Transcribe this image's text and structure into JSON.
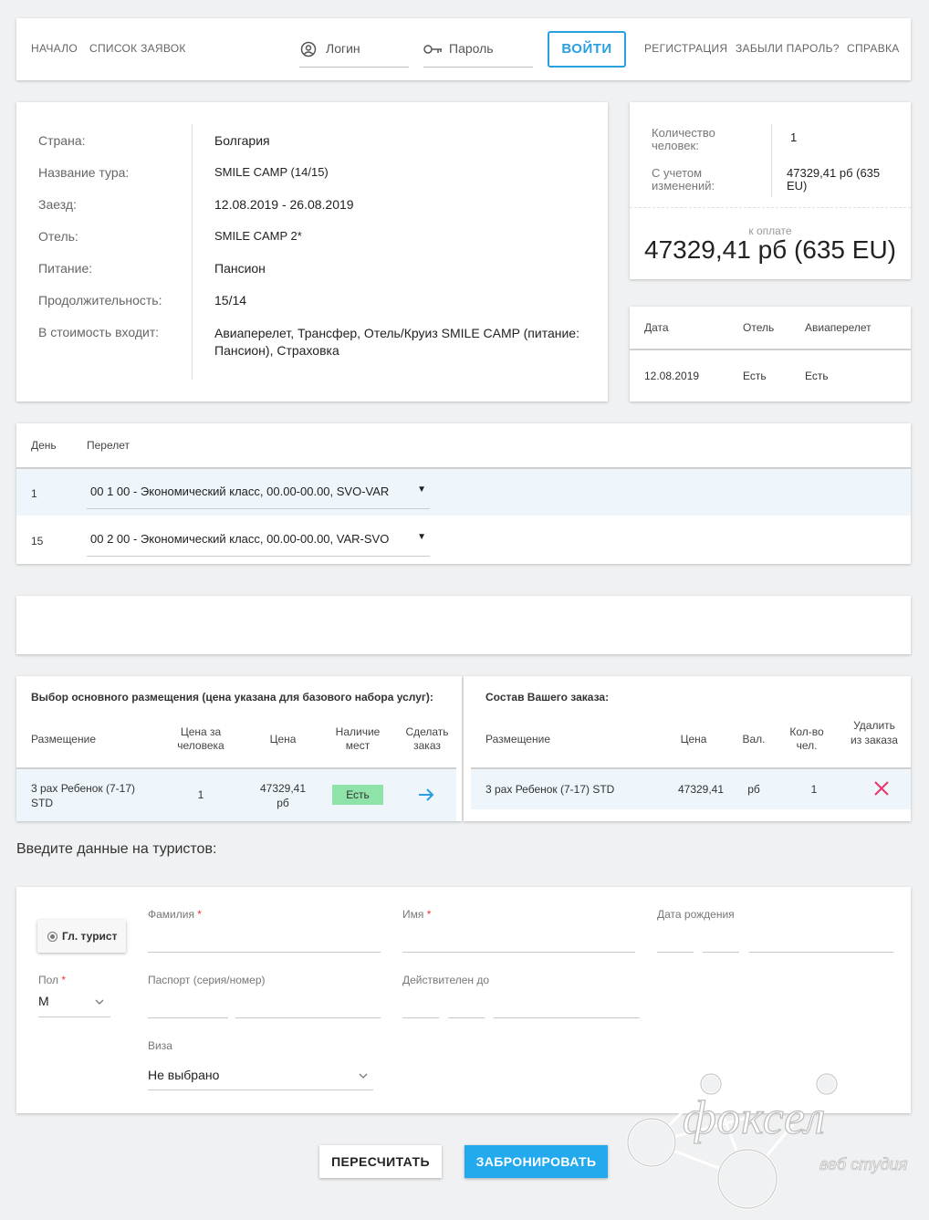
{
  "header": {
    "nav_left": [
      "НАЧАЛО",
      "СПИСОК ЗАЯВОК"
    ],
    "login_placeholder": "Логин",
    "password_placeholder": "Пароль",
    "login_button": "ВОЙТИ",
    "nav_right": [
      "РЕГИСТРАЦИЯ",
      "ЗАБЫЛИ ПАРОЛЬ?",
      "СПРАВКА"
    ]
  },
  "tour": {
    "rows": [
      {
        "label": "Страна:",
        "value": "Болгария",
        "link": false
      },
      {
        "label": "Название тура:",
        "value": "SMILE CAMP (14/15)",
        "link": true
      },
      {
        "label": "Заезд:",
        "value": "12.08.2019 - 26.08.2019",
        "link": false
      },
      {
        "label": "Отель:",
        "value": "SMILE CAMP 2*",
        "link": true
      },
      {
        "label": "Питание:",
        "value": "Пансион",
        "link": false
      },
      {
        "label": "Продолжительность:",
        "value": "15/14",
        "link": false
      },
      {
        "label": "В стоимость входит:",
        "value": "Авиаперелет, Трансфер, Отель/Круиз SMILE CAMP (питание: Пансион), Страховка",
        "link": false
      }
    ]
  },
  "summary": {
    "people_label": "Количество человек:",
    "people_value": "1",
    "changes_label": "С учетом изменений:",
    "changes_value": "47329,41 рб (635 EU)",
    "to_pay_label": "к оплате",
    "to_pay_value": "47329,41 рб (635 EU)"
  },
  "dates_table": {
    "headers": [
      "Дата",
      "Отель",
      "Авиаперелет"
    ],
    "row": [
      "12.08.2019",
      "Есть",
      "Есть"
    ]
  },
  "flights": {
    "headers": [
      "День",
      "Перелет"
    ],
    "rows": [
      {
        "day": "1",
        "flight": "00 1 00 - Экономический класс, 00.00-00.00, SVO-VAR"
      },
      {
        "day": "15",
        "flight": "00 2 00 - Экономический класс, 00.00-00.00, VAR-SVO"
      }
    ]
  },
  "accommodation": {
    "title": "Выбор основного размещения (цена указана для базового набора услуг):",
    "headers": [
      "Размещение",
      "Цена за человека",
      "Цена",
      "Наличие мест",
      "Сделать заказ"
    ],
    "row": {
      "placement": "3 pax Ребенок (7-17) STD",
      "per_person": "1",
      "price": "47329,41 рб",
      "availability": "Есть"
    }
  },
  "order": {
    "title": "Состав Вашего заказа:",
    "headers": [
      "Размещение",
      "Цена",
      "Вал.",
      "Кол-во чел.",
      "Удалить из заказа"
    ],
    "row": {
      "placement": "3 pax Ребенок (7-17) STD",
      "price": "47329,41",
      "currency": "рб",
      "count": "1"
    }
  },
  "tourists": {
    "heading": "Введите данные на туристов:",
    "main_tourist": "Гл. турист",
    "surname_label": "Фамилия",
    "name_label": "Имя",
    "birth_label": "Дата рождения",
    "sex_label": "Пол",
    "sex_value": "М",
    "passport_label": "Паспорт (серия/номер)",
    "valid_label": "Действителен до",
    "visa_label": "Виза",
    "visa_value": "Не выбрано",
    "required_mark": "*"
  },
  "actions": {
    "recalc": "ПЕРЕСЧИТАТЬ",
    "book": "ЗАБРОНИРОВАТЬ"
  },
  "watermark": {
    "brand": "фоксел",
    "sub": "веб студия"
  },
  "colors": {
    "accent": "#2a9fe0",
    "link": "#2a95d9",
    "primary_button": "#22a9ee",
    "available_badge": "#8fe3a8",
    "delete": "#e8356b",
    "row_highlight": "#eef6fb"
  }
}
